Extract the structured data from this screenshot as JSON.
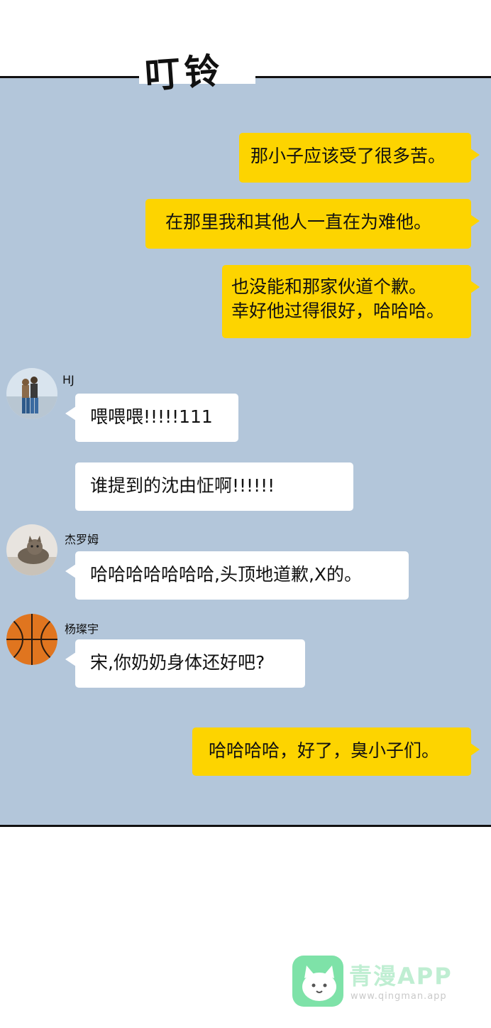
{
  "sfx": "叮铃",
  "messages": [
    {
      "text": "那小子应该受了很多苦。"
    },
    {
      "text": "在那里我和其他人一直在为难他。"
    },
    {
      "line1": "也没能和那家伙道个歉。",
      "line2": "幸好他过得很好，哈哈哈。"
    },
    {
      "name": "HJ",
      "text": "喂喂喂!!!!!111"
    },
    {
      "text": "谁提到的沈由怔啊!!!!!!"
    },
    {
      "name": "杰罗姆",
      "text": "哈哈哈哈哈哈哈,头顶地道歉,X的。"
    },
    {
      "name": "杨璨宇",
      "text": "宋,你奶奶身体还好吧?"
    },
    {
      "text": "哈哈哈哈，好了，臭小子们。"
    }
  ],
  "watermark": {
    "title": "青漫APP",
    "sub": "www.qingman.app"
  },
  "colors": {
    "panel": "#b3c6da",
    "own_bubble": "#fdd400",
    "other_bubble": "#ffffff"
  }
}
